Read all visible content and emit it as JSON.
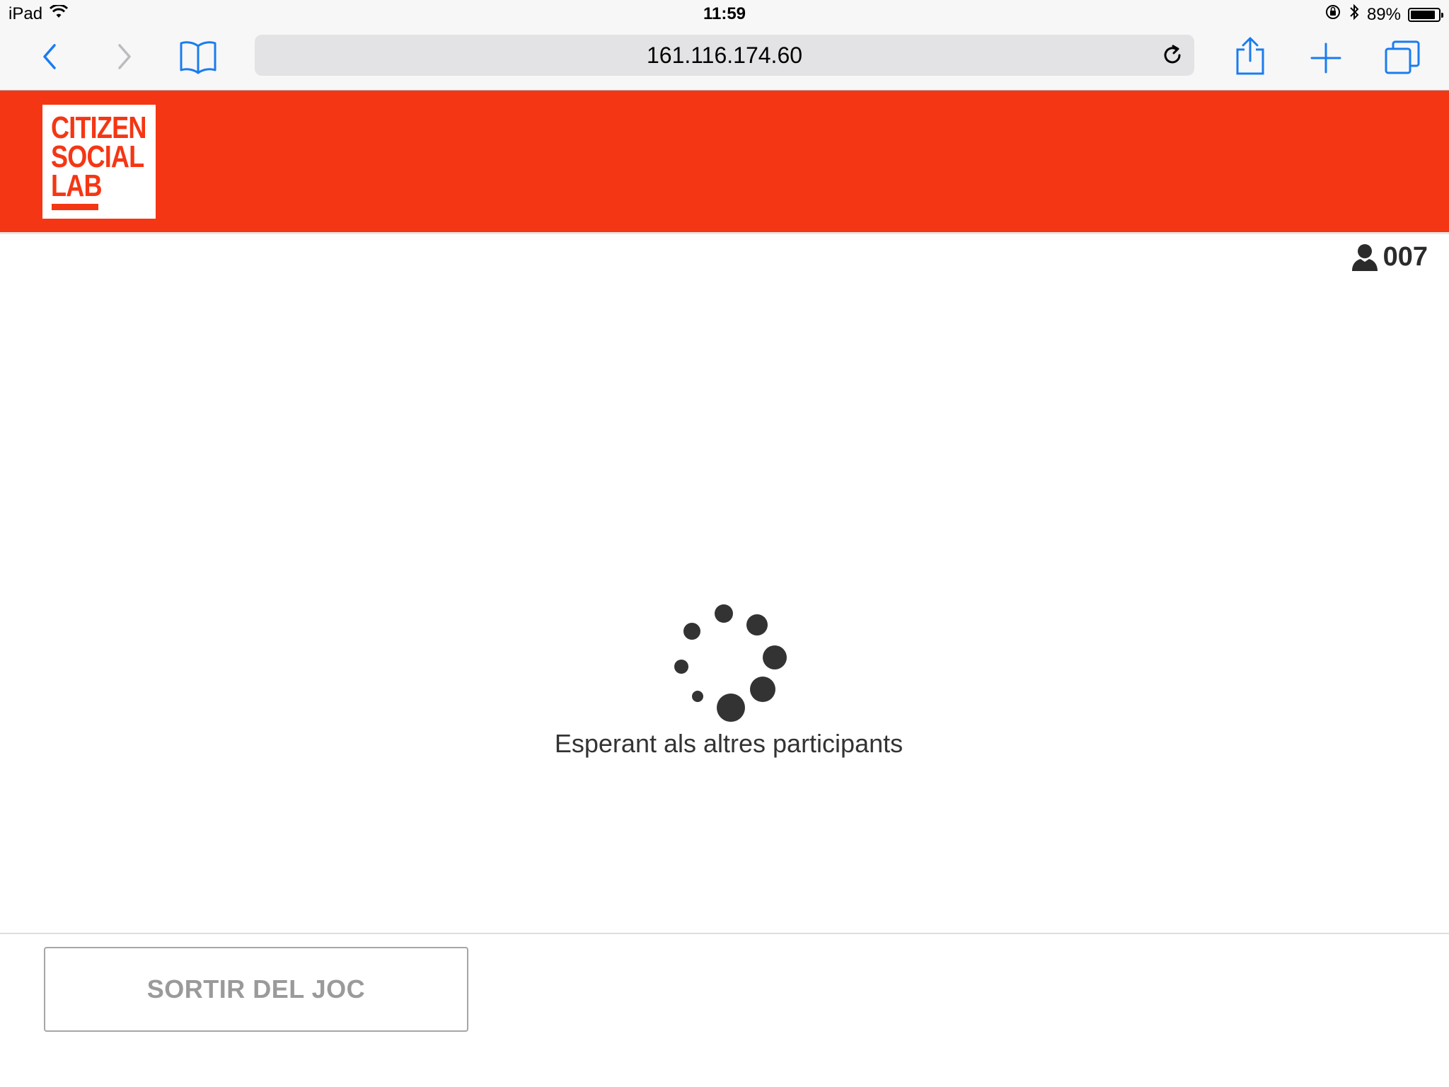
{
  "status_bar": {
    "device": "iPad",
    "time": "11:59",
    "battery_percent": "89%",
    "battery_level": 0.89,
    "icons": [
      "wifi-icon",
      "rotation-lock-icon",
      "bluetooth-icon",
      "battery-icon"
    ]
  },
  "browser": {
    "url": "161.116.174.60",
    "buttons": [
      "back",
      "forward",
      "bookmarks",
      "reload",
      "share",
      "new-tab",
      "tabs"
    ],
    "accent_color": "#1a7cf0"
  },
  "header": {
    "logo_lines": [
      "CITIZEN",
      "SOCIAL",
      "LAB"
    ],
    "brand_color": "#f53614"
  },
  "user": {
    "icon": "user-icon",
    "id": "007"
  },
  "waiting": {
    "message": "Esperant als altres participants",
    "icon": "loading-spinner"
  },
  "actions": {
    "exit_label": "SORTIR DEL JOC"
  }
}
